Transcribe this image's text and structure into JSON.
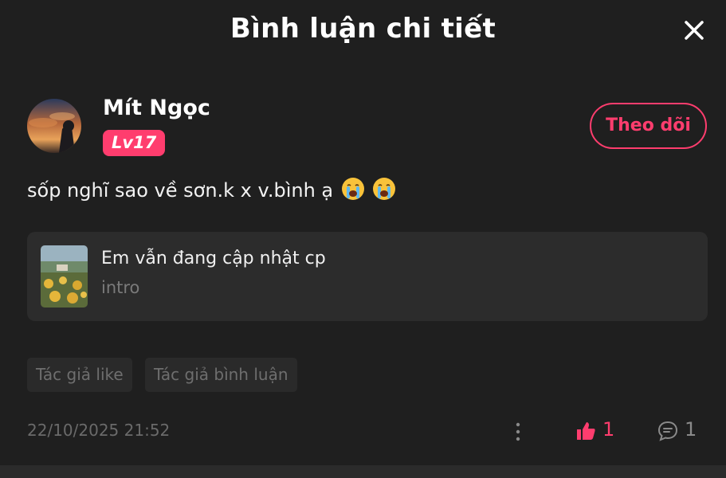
{
  "header": {
    "title": "Bình luận chi tiết",
    "close_icon": "close-icon"
  },
  "comment": {
    "author_name": "Mít Ngọc",
    "level_badge": "Lv17",
    "follow_label": "Theo dõi",
    "text": "sốp nghĩ sao về sơn.k x v.bình ạ",
    "emojis": [
      "crying-face-emoji",
      "crying-face-emoji"
    ],
    "timestamp": "22/10/2025 21:52",
    "like_count": "1",
    "reply_count": "1"
  },
  "book_card": {
    "title": "Em vẫn đang cập nhật cp",
    "subtitle": "intro"
  },
  "tags": [
    "Tác giả like",
    "Tác giả bình luận"
  ],
  "colors": {
    "background": "#1f1f1f",
    "accent": "#ff3d6e",
    "card": "#2c2c2c",
    "muted": "#6e6e6e"
  }
}
